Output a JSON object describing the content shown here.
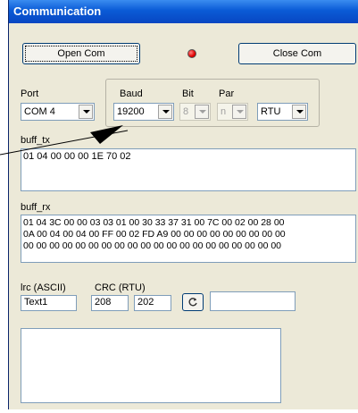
{
  "window": {
    "title": "Communication"
  },
  "buttons": {
    "open_com": "Open Com",
    "close_com": "Close Com"
  },
  "port": {
    "label": "Port",
    "value": "COM 4"
  },
  "baud": {
    "label": "Baud",
    "value": "19200"
  },
  "bit": {
    "label": "Bit",
    "value": "8"
  },
  "par": {
    "label": "Par",
    "value": "n"
  },
  "mode": {
    "value": "RTU"
  },
  "buff_tx": {
    "label": "buff_tx",
    "value": "01 04 00 00 00 1E 70 02"
  },
  "buff_rx": {
    "label": "buff_rx",
    "lines": [
      "01 04 3C 00 00 03 03 01 00 30 33 37 31 00 7C 00 02 00 28 00",
      "0A 00 04 00 04 00 FF 00 02 FD A9 00 00 00 00 00 00 00 00 00",
      "00 00 00 00 00 00 00 00 00 00 00 00 00 00 00 00 00 00 00 00"
    ]
  },
  "lrc": {
    "label": "lrc (ASCII)",
    "value": "Text1"
  },
  "crc": {
    "label": "CRC (RTU)",
    "value1": "208",
    "value2": "202"
  },
  "colors": {
    "title_bar": "#0a5bd6",
    "led": "#e00000",
    "window_bg": "#ece9d8"
  }
}
